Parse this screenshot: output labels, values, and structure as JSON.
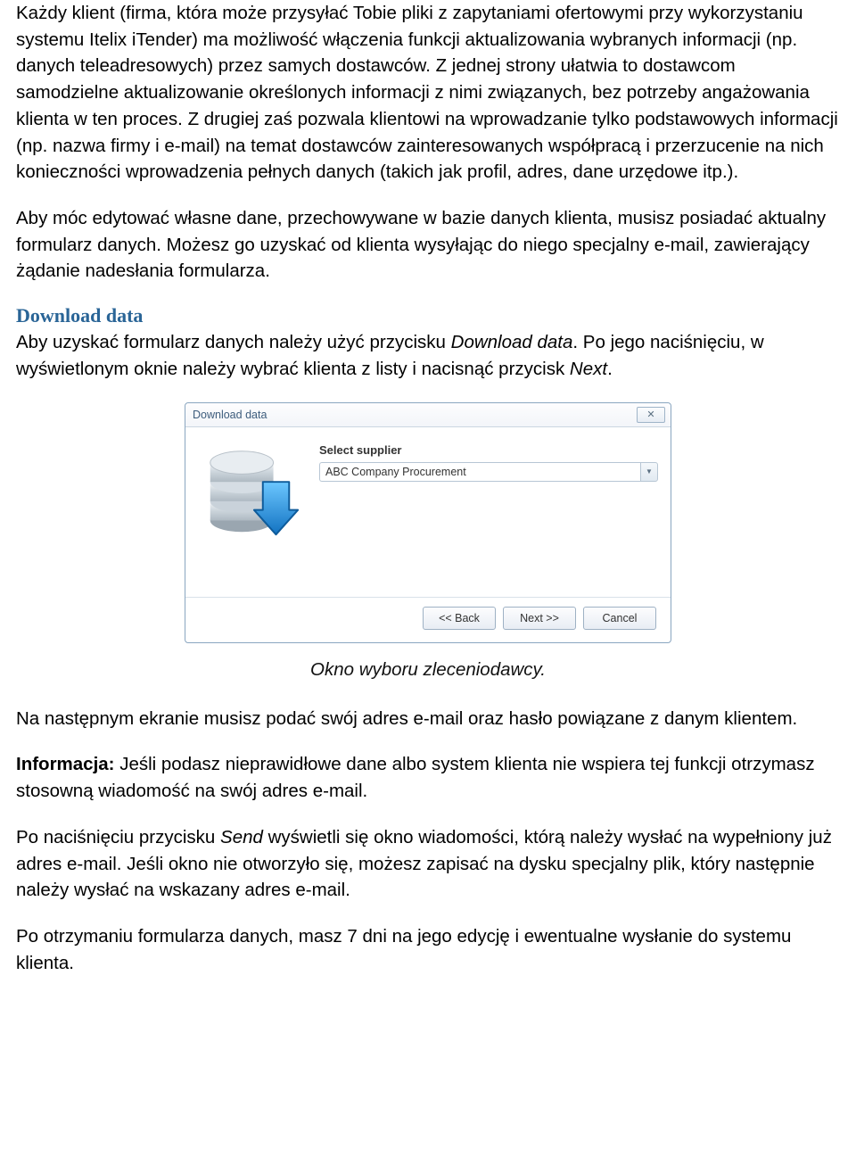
{
  "paragraphs": {
    "p1": "Każdy klient (firma, która może przysyłać Tobie pliki z zapytaniami ofertowymi przy wykorzystaniu systemu Itelix iTender) ma możliwość włączenia funkcji aktualizowania wybranych informacji (np. danych teleadresowych) przez samych dostawców. Z jednej strony ułatwia to dostawcom samodzielne aktualizowanie określonych informacji z nimi związanych, bez potrzeby angażowania klienta w ten proces. Z drugiej zaś pozwala klientowi na wprowadzanie tylko podstawowych informacji (np. nazwa firmy i e-mail) na temat dostawców zainteresowanych współpracą i przerzucenie na nich konieczności wprowadzenia pełnych danych (takich jak profil, adres, dane urzędowe itp.).",
    "p2": "Aby móc edytować własne dane, przechowywane w bazie danych klienta, musisz posiadać aktualny formularz danych. Możesz go uzyskać od klienta wysyłając do niego specjalny e-mail, zawierający żądanie nadesłania formularza.",
    "heading": "Download data",
    "p3_a": "Aby uzyskać formularz danych należy użyć przycisku ",
    "p3_b": "Download data",
    "p3_c": ". Po jego naciśnięciu, w wyświetlonym oknie należy wybrać klienta z listy i nacisnąć przycisk ",
    "p3_d": "Next",
    "p3_e": ".",
    "caption": "Okno wyboru zleceniodawcy.",
    "p4": "Na następnym ekranie musisz podać swój adres e-mail oraz hasło powiązane z danym klientem.",
    "p5_a": "Informacja:",
    "p5_b": " Jeśli podasz nieprawidłowe dane albo system klienta nie wspiera tej funkcji otrzymasz stosowną wiadomość na swój adres e-mail.",
    "p6_a": "Po naciśnięciu przycisku ",
    "p6_b": "Send",
    "p6_c": " wyświetli się okno wiadomości, którą należy wysłać na wypełniony już adres e-mail. Jeśli okno nie otworzyło się, możesz zapisać na dysku specjalny plik, który następnie należy wysłać na wskazany adres e-mail.",
    "p7": "Po otrzymaniu formularza danych, masz 7 dni na jego edycję i ewentualne wysłanie do systemu klienta."
  },
  "dialog": {
    "title": "Download data",
    "label": "Select supplier",
    "selected": "ABC Company Procurement",
    "buttons": {
      "back": "<< Back",
      "next": "Next >>",
      "cancel": "Cancel"
    }
  }
}
